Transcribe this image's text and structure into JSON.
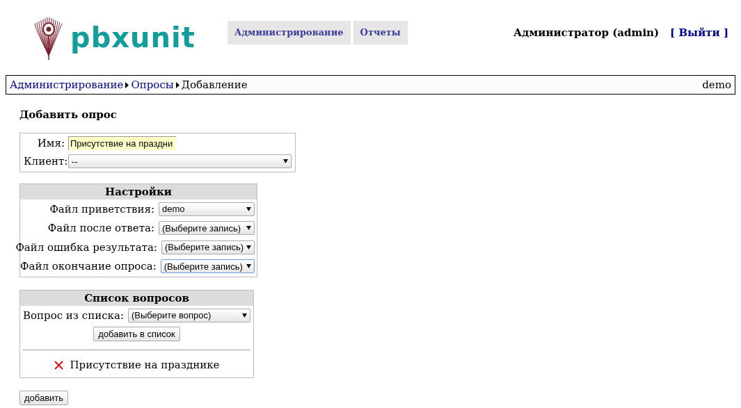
{
  "header": {
    "logo_text": "pbxunit",
    "nav": [
      {
        "label": "Администрирование",
        "selected": false
      },
      {
        "label": "Отчеты",
        "selected": false
      }
    ],
    "user": "Администратор (admin)",
    "logout": "[ Выйти ]"
  },
  "breadcrumb": {
    "items": [
      {
        "label": "Администрирование",
        "kind": "link"
      },
      {
        "label": "Опросы",
        "kind": "link"
      },
      {
        "label": "Добавление",
        "kind": "current"
      }
    ],
    "right": "demo"
  },
  "title": "Добавить опрос",
  "main_form": {
    "name": {
      "label": "Имя:",
      "value": "Присутствие на праздни"
    },
    "client": {
      "label": "Клиент:",
      "value": "--"
    }
  },
  "settings": {
    "title": "Настройки",
    "rows": [
      {
        "label": "Файл приветствия:",
        "value": "demo",
        "focused": false
      },
      {
        "label": "Файл после ответа:",
        "value": "(Выберите запись)",
        "focused": false
      },
      {
        "label": "Файл ошибка результата:",
        "value": "(Выберите запись)",
        "focused": false
      },
      {
        "label": "Файл окончание опроса:",
        "value": "(Выберите запись)",
        "focused": true
      }
    ]
  },
  "questions": {
    "title": "Список вопросов",
    "select_label": "Вопрос из списка:",
    "select_value": "(Выберите вопрос)",
    "add_button": "добавить в список",
    "items": [
      "Присутствие на празднике"
    ]
  },
  "submit": "добавить"
}
